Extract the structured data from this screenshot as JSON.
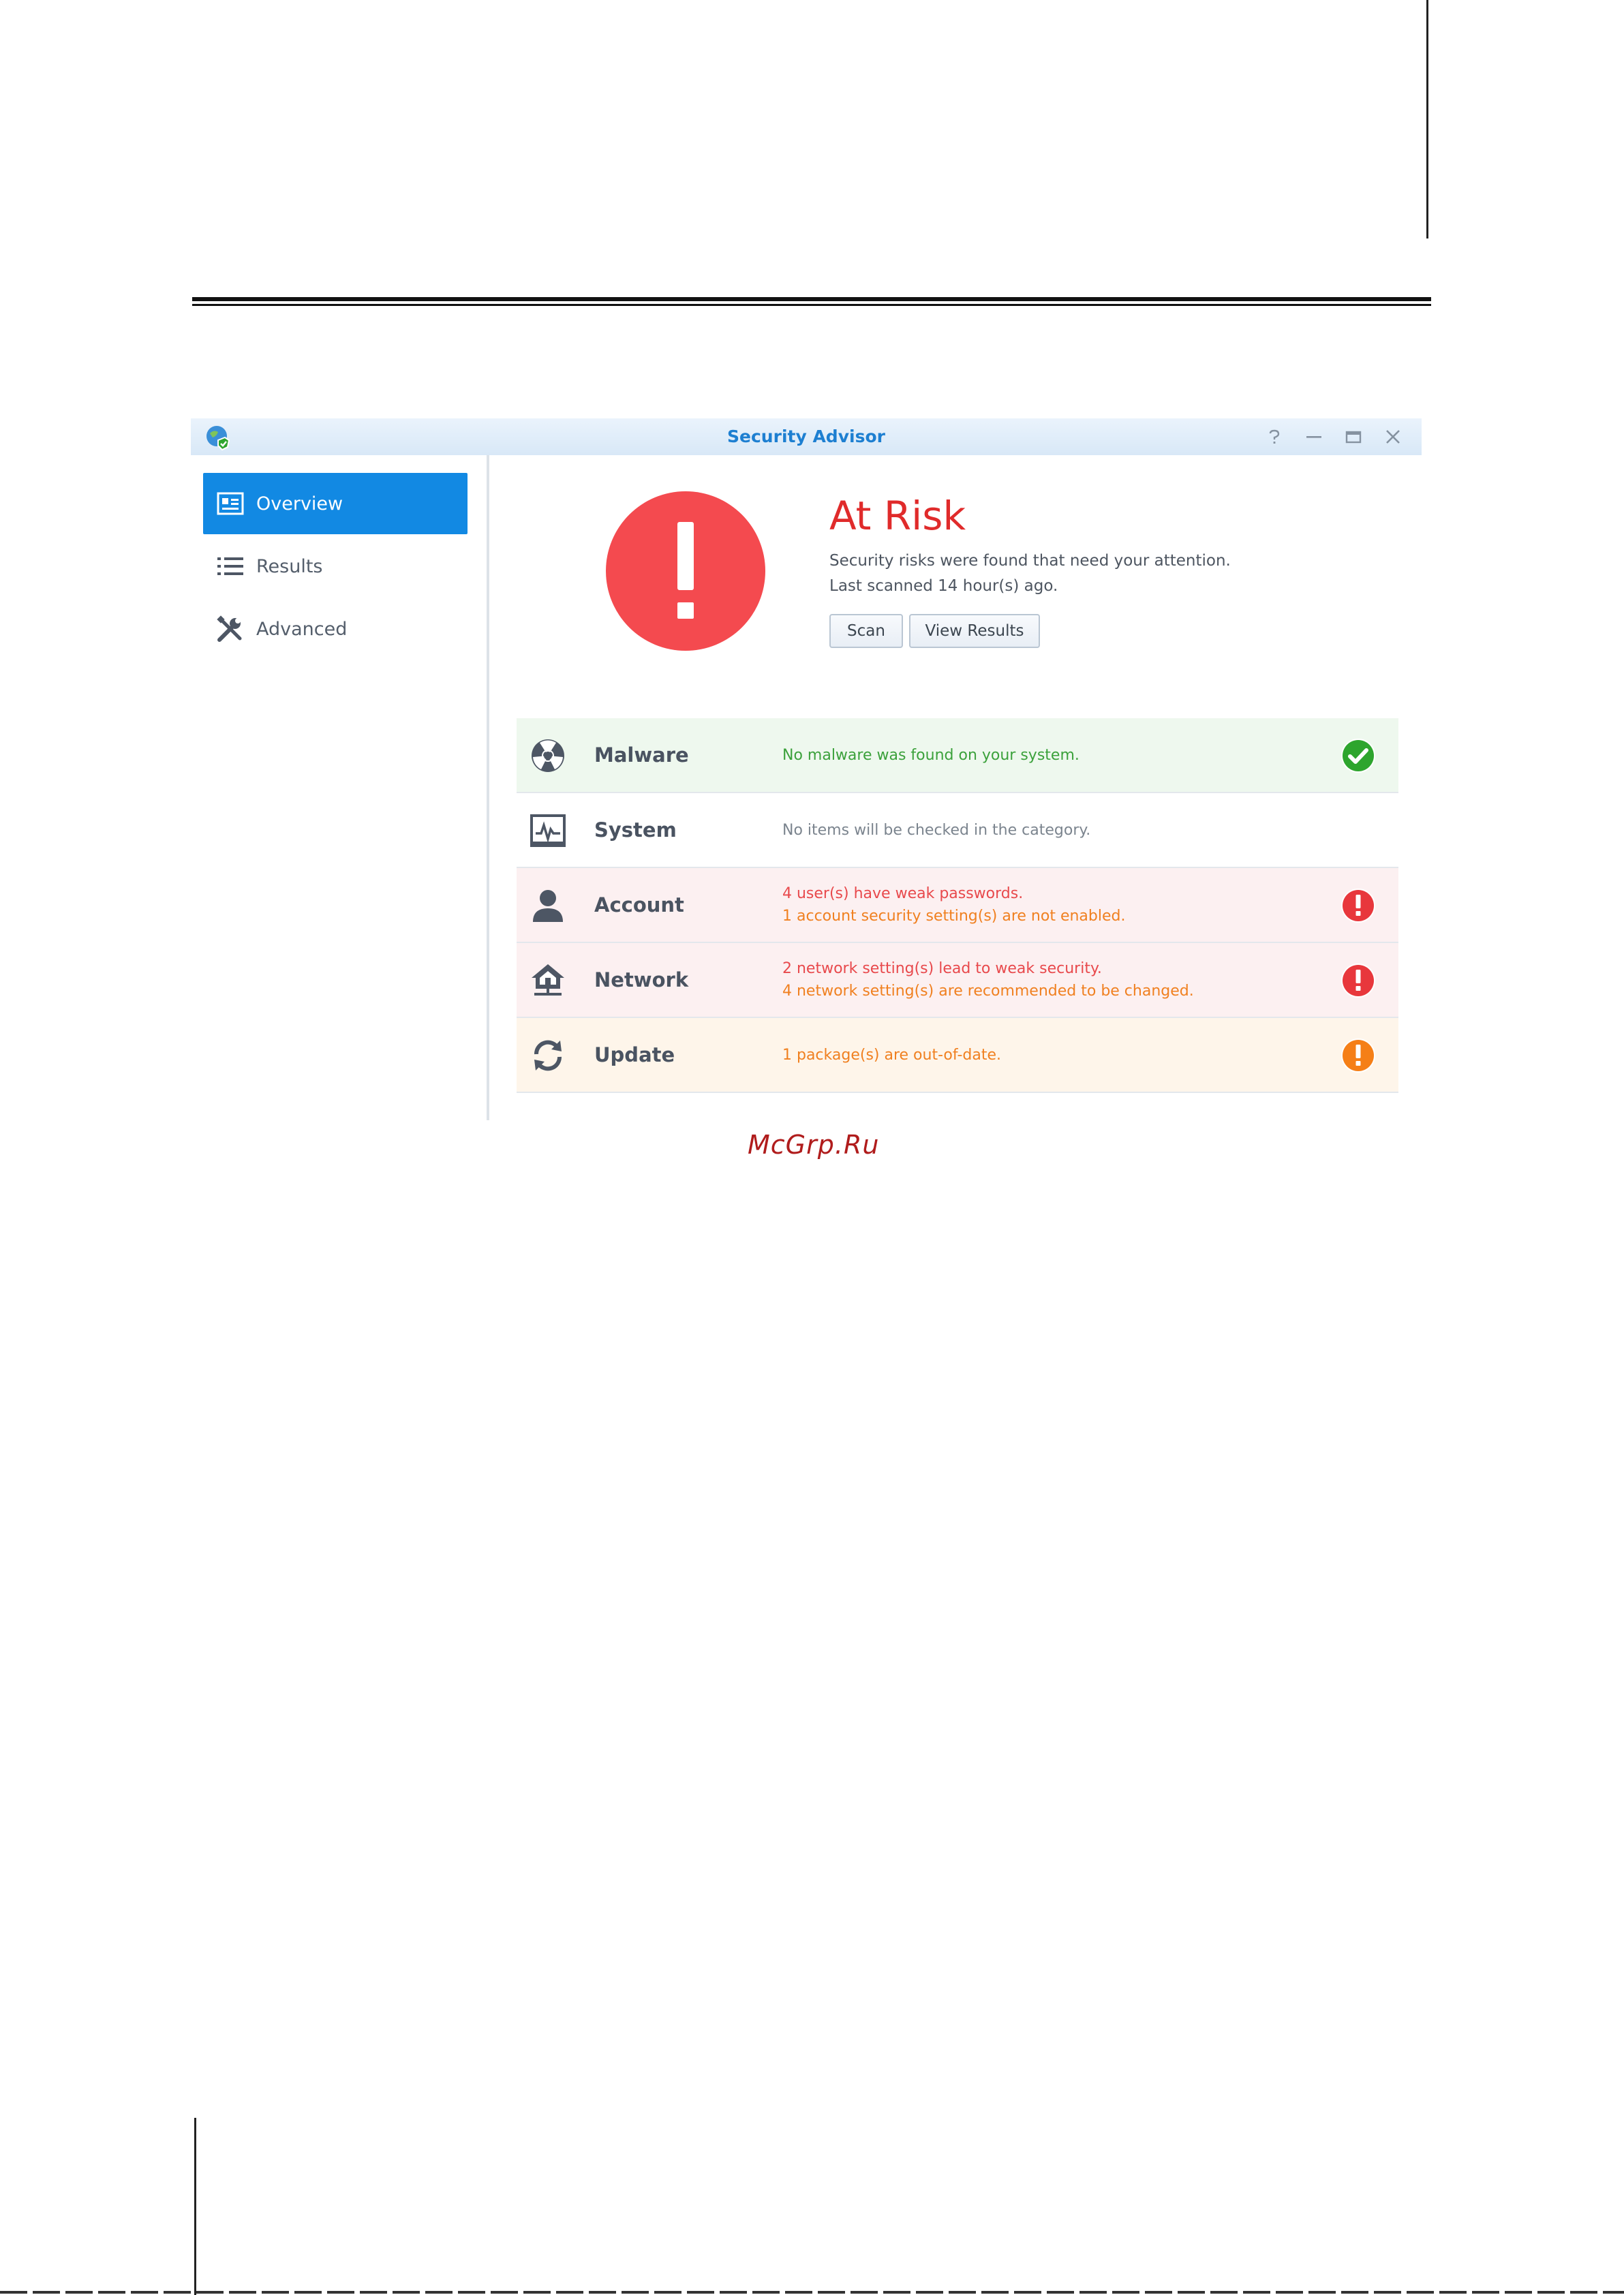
{
  "window": {
    "title": "Security Advisor"
  },
  "sidebar": {
    "items": [
      {
        "label": "Overview",
        "icon": "overview-icon",
        "active": true
      },
      {
        "label": "Results",
        "icon": "list-icon",
        "active": false
      },
      {
        "label": "Advanced",
        "icon": "tools-icon",
        "active": false
      }
    ]
  },
  "status": {
    "title": "At Risk",
    "line1": "Security risks were found that need your attention.",
    "line2": "Last scanned 14 hour(s) ago.",
    "scan_label": "Scan",
    "view_results_label": "View Results"
  },
  "categories": [
    {
      "name": "Malware",
      "icon": "radiation-icon",
      "messages": [
        "No malware was found on your system."
      ],
      "status": "ok"
    },
    {
      "name": "System",
      "icon": "monitor-icon",
      "messages": [
        "No items will be checked in the category."
      ],
      "status": "none"
    },
    {
      "name": "Account",
      "icon": "user-icon",
      "messages": [
        "4 user(s) have weak passwords.",
        "1 account security setting(s) are not enabled."
      ],
      "status": "danger"
    },
    {
      "name": "Network",
      "icon": "network-home-icon",
      "messages": [
        "2 network setting(s) lead to weak security.",
        "4 network setting(s) are recommended to be changed."
      ],
      "status": "danger"
    },
    {
      "name": "Update",
      "icon": "refresh-icon",
      "messages": [
        "1 package(s) are out-of-date."
      ],
      "status": "warning"
    }
  ],
  "colors": {
    "accent": "#1289e3",
    "danger": "#f44a4f",
    "warning": "#f57f17",
    "ok": "#2ea52e"
  },
  "watermark": "McGrp.Ru"
}
